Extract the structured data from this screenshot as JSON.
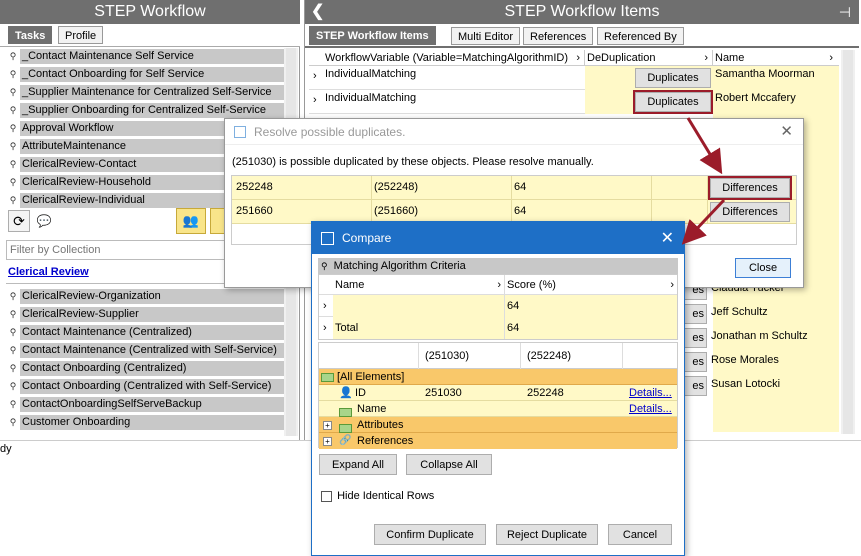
{
  "left_panel": {
    "title": "STEP Workflow",
    "tabs": [
      "Tasks",
      "Profile"
    ],
    "items_top": [
      "_Contact Maintenance Self Service",
      "_Contact Onboarding for Self Service",
      "_Supplier Maintenance for Centralized Self-Service",
      "_Supplier Onboarding for Centralized Self-Service",
      "Approval Workflow",
      "AttributeMaintenance",
      "ClericalReview-Contact",
      "ClericalReview-Household",
      "ClericalReview-Individual"
    ],
    "filter_placeholder": "Filter by Collection",
    "section_link": "Clerical Review",
    "items_bottom": [
      "ClericalReview-Organization",
      "ClericalReview-Supplier",
      "Contact Maintenance (Centralized)",
      "Contact Maintenance (Centralized with Self-Service)",
      "Contact Onboarding (Centralized)",
      "Contact Onboarding (Centralized with Self-Service)",
      "ContactOnboardingSelfServeBackup",
      "Customer Onboarding"
    ],
    "status": "dy"
  },
  "right_panel": {
    "title": "STEP Workflow Items",
    "tabs": [
      "STEP Workflow Items",
      "Multi Editor",
      "References",
      "Referenced By"
    ],
    "columns": [
      "WorkflowVariable (Variable=MatchingAlgorithmID)",
      "DeDuplication",
      "Name"
    ],
    "rows": [
      {
        "variable": "IndividualMatching",
        "dedup": "Duplicates",
        "name": "Samantha Moorman"
      },
      {
        "variable": "IndividualMatching",
        "dedup": "Duplicates",
        "name": "Robert Mccafery"
      }
    ],
    "hidden_names": [
      "Claudia Tucker",
      "Jeff Schultz",
      "Jonathan m Schultz",
      "Rose Morales",
      "Susan Lotocki"
    ],
    "partial_btn": "es"
  },
  "resolve_dialog": {
    "title": "Resolve possible duplicates.",
    "message": "(251030) is possible duplicated by these objects. Please resolve manually.",
    "rows": [
      {
        "id": "252248",
        "ref": "(252248)",
        "score": "64",
        "button": "Differences"
      },
      {
        "id": "251660",
        "ref": "(251660)",
        "score": "64",
        "button": "Differences"
      }
    ],
    "close": "Close"
  },
  "compare_dialog": {
    "title": "Compare",
    "section": "Matching Algorithm Criteria",
    "criteria_cols": [
      "Name",
      "Score (%)"
    ],
    "criteria_rows": [
      {
        "name": "",
        "score": "64"
      },
      {
        "name": "Total",
        "score": "64"
      }
    ],
    "compare_cols": [
      "(251030)",
      "(252248)"
    ],
    "tree": {
      "all": "[All Elements]",
      "id_label": "ID",
      "id_a": "251030",
      "id_b": "252248",
      "name_label": "Name",
      "attributes": "Attributes",
      "references": "References",
      "details": "Details..."
    },
    "expand_all": "Expand All",
    "collapse_all": "Collapse All",
    "hide_identical": "Hide Identical Rows",
    "confirm": "Confirm Duplicate",
    "reject": "Reject Duplicate",
    "cancel": "Cancel"
  },
  "colors": {
    "header_gray": "#6f6f6f",
    "row_yellow": "#fff9c7",
    "tree_orange": "#f9c86a",
    "highlight_red": "#9b1c2a",
    "dialog_blue": "#1e6fc6"
  }
}
